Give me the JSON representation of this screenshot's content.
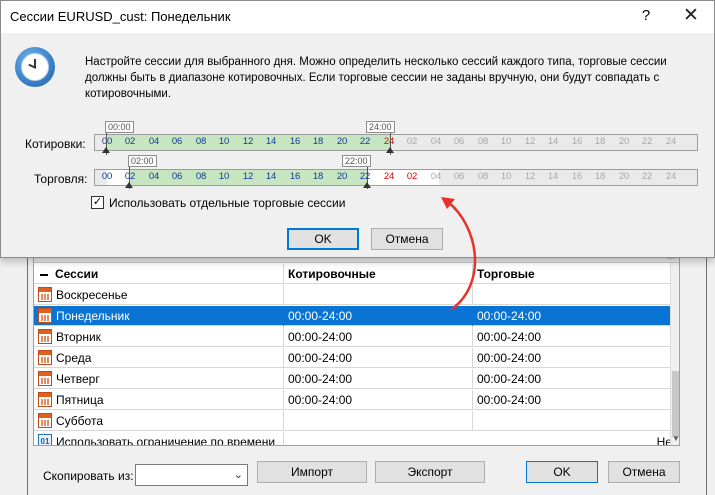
{
  "dialog": {
    "title": "Сессии EURUSD_cust: Понедельник",
    "help_icon": "?",
    "close_icon": "✕",
    "description": "Настройте сессии для выбранного дня. Можно определить несколько сессий каждого типа, торговые сессии должны быть в диапазоне котировочных. Если торговые сессии не заданы вручную, они будут совпадать с котировочными.",
    "quotes_label": "Котировки:",
    "trade_label": "Торговля:",
    "quotes_tip_start": "00:00",
    "quotes_tip_end": "24:00",
    "trade_tip_start": "02:00",
    "trade_tip_end": "22:00",
    "hour_marks": [
      "00",
      "02",
      "04",
      "06",
      "08",
      "10",
      "12",
      "14",
      "16",
      "18",
      "20",
      "22",
      "24",
      "02",
      "04",
      "06",
      "08",
      "10",
      "12",
      "14",
      "16",
      "18",
      "20",
      "22",
      "24"
    ],
    "checkbox_mark": "✓",
    "checkbox_label": "Использовать отдельные торговые сессии",
    "ok_label": "OK",
    "cancel_label": "Отмена"
  },
  "parent": {
    "grid_more": "...",
    "headers": [
      "Сессии",
      "Котировочные",
      "Торговые"
    ],
    "rows": [
      {
        "day": "Воскресенье",
        "quotes": "",
        "trade": ""
      },
      {
        "day": "Понедельник",
        "quotes": "00:00-24:00",
        "trade": "00:00-24:00"
      },
      {
        "day": "Вторник",
        "quotes": "00:00-24:00",
        "trade": "00:00-24:00"
      },
      {
        "day": "Среда",
        "quotes": "00:00-24:00",
        "trade": "00:00-24:00"
      },
      {
        "day": "Четверг",
        "quotes": "00:00-24:00",
        "trade": "00:00-24:00"
      },
      {
        "day": "Пятница",
        "quotes": "00:00-24:00",
        "trade": "00:00-24:00"
      },
      {
        "day": "Суббота",
        "quotes": "",
        "trade": ""
      }
    ],
    "time_limit": {
      "icon_text": "01",
      "label": "Использовать ограничение по времени",
      "value": "Нет"
    },
    "copy_from_label": "Скопировать из:",
    "copy_from_value": "",
    "import_label": "Импорт",
    "export_label": "Экспорт",
    "ok_label": "OK",
    "cancel_label": "Отмена"
  },
  "colors": {
    "accent": "#0078d7",
    "selection": "#0a74d4",
    "session_fill": "#c8e5c1",
    "annotation_arrow": "#e8312a"
  }
}
